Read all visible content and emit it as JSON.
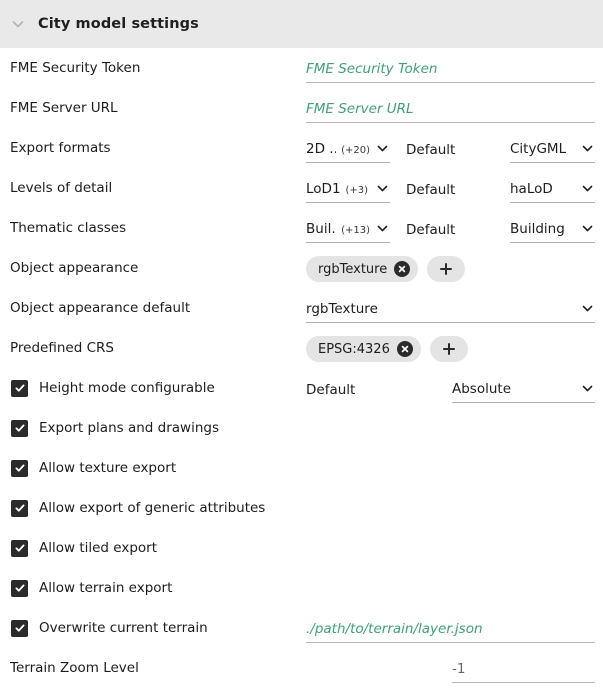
{
  "header": {
    "title": "City model settings",
    "collapse_icon": "chevron-down-icon"
  },
  "fields": {
    "fme_security_token": {
      "label": "FME Security Token",
      "placeholder": "FME Security Token",
      "value": ""
    },
    "fme_server_url": {
      "label": "FME Server URL",
      "placeholder": "FME Server URL",
      "value": ""
    },
    "export_formats": {
      "label": "Export formats",
      "selection": "2D ...",
      "badge": "(+20)",
      "default_label": "Default",
      "default_value": "CityGML"
    },
    "levels_of_detail": {
      "label": "Levels of detail",
      "selection": "LoD1",
      "badge": "(+3)",
      "default_label": "Default",
      "default_value": "haLoD"
    },
    "thematic_classes": {
      "label": "Thematic classes",
      "selection": "Buil...",
      "badge": "(+13)",
      "default_label": "Default",
      "default_value": "Building"
    },
    "object_appearance": {
      "label": "Object appearance",
      "chips": [
        "rgbTexture"
      ],
      "add_label": "+"
    },
    "object_appearance_default": {
      "label": "Object appearance default",
      "value": "rgbTexture"
    },
    "predefined_crs": {
      "label": "Predefined CRS",
      "chips": [
        "EPSG:4326"
      ],
      "add_label": "+"
    },
    "height_mode_configurable": {
      "label": "Height mode configurable",
      "checked": true,
      "default_label": "Default",
      "default_value": "Absolute"
    },
    "export_plans_and_drawings": {
      "label": "Export plans and drawings",
      "checked": true
    },
    "allow_texture_export": {
      "label": "Allow texture export",
      "checked": true
    },
    "allow_export_generic_attributes": {
      "label": "Allow export of generic attributes",
      "checked": true
    },
    "allow_tiled_export": {
      "label": "Allow tiled export",
      "checked": true
    },
    "allow_terrain_export": {
      "label": "Allow terrain export",
      "checked": true
    },
    "overwrite_current_terrain": {
      "label": "Overwrite current terrain",
      "checked": true,
      "placeholder": "./path/to/terrain/layer.json",
      "value": ""
    },
    "terrain_zoom_level": {
      "label": "Terrain Zoom Level",
      "value": "-1"
    }
  },
  "colors": {
    "header_bg": "#e9e9e9",
    "placeholder_green": "#3fa07a",
    "chip_bg": "#e4e4e4",
    "control_dark": "#2b2b2b",
    "underline": "#b0b0b0"
  }
}
